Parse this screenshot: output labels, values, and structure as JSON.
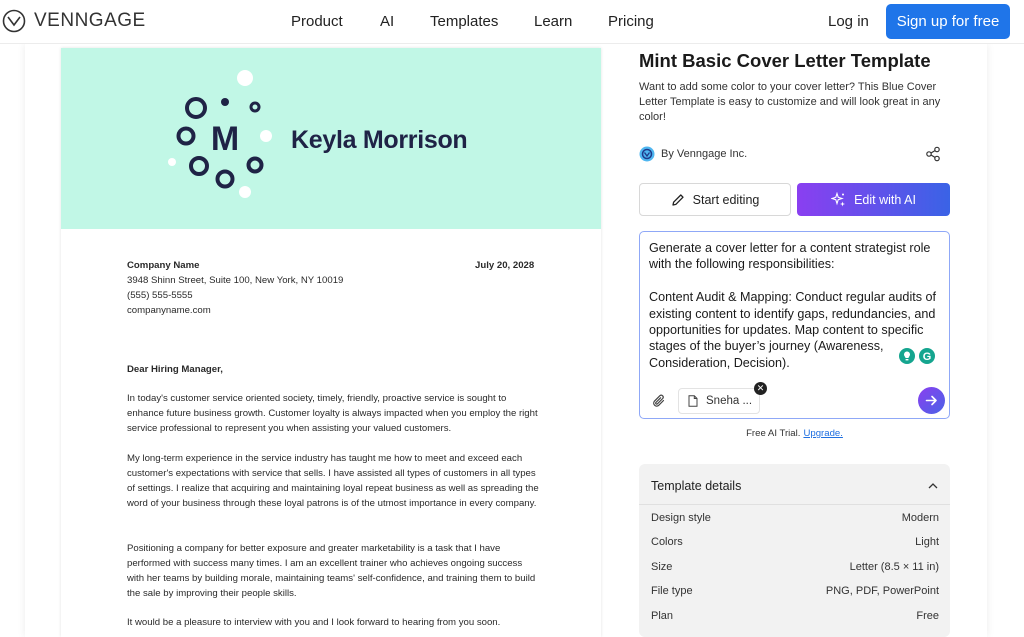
{
  "nav": {
    "brand": "VENNGAGE",
    "links": [
      "Product",
      "AI",
      "Templates",
      "Learn",
      "Pricing"
    ],
    "login": "Log in",
    "signup": "Sign up for free"
  },
  "letter": {
    "monogram": "M",
    "person_name": "Keyla Morrison",
    "company_name": "Company Name",
    "date": "July 20, 2028",
    "address": "3948 Shinn Street, Suite 100, New York, NY 10019",
    "phone": "(555) 555-5555",
    "website": "companyname.com",
    "salutation": "Dear Hiring Manager,",
    "paragraphs": [
      "In today's customer service oriented society, timely, friendly, proactive service is sought to enhance future business growth. Customer loyalty is always impacted when you employ the right service professional to represent you when assisting your valued customers.",
      "My long-term experience in the service industry has taught me how to meet and exceed each customer's expectations with service that sells. I have assisted all types of customers in all types of settings. I realize that acquiring and maintaining loyal repeat business as well as spreading the word of your business through these loyal patrons is of the utmost importance in every company.",
      "Positioning a company for better exposure and greater marketability is a task that I have performed with success many times. I am an excellent trainer who achieves ongoing success with her teams by building morale, maintaining teams' self-confidence, and training them to build the sale by improving their people skills.",
      "It would be a pleasure to interview with you and I look forward to hearing from you soon."
    ]
  },
  "panel": {
    "title": "Mint Basic Cover Letter Template",
    "description": "Want to add some color to your cover letter? This Blue Cover Letter Template is easy to customize and will look great in any color!",
    "author": "By Venngage Inc.",
    "start_editing": "Start editing",
    "edit_with_ai": "Edit with AI",
    "prompt": "Generate a cover letter for a content strategist role with the following responsibilities:\n\nContent Audit & Mapping: Conduct regular audits of existing content to identify gaps, redundancies, and opportunities for updates. Map content to specific stages of the buyer’s journey (Awareness, Consideration, Decision).",
    "attachment": "Sneha ...",
    "trial_text": "Free AI Trial.",
    "upgrade": "Upgrade."
  },
  "details": {
    "title": "Template details",
    "rows": [
      {
        "label": "Design style",
        "value": "Modern"
      },
      {
        "label": "Colors",
        "value": "Light"
      },
      {
        "label": "Size",
        "value": "Letter (8.5 × 11 in)"
      },
      {
        "label": "File type",
        "value": "PNG, PDF, PowerPoint"
      },
      {
        "label": "Plan",
        "value": "Free"
      }
    ]
  },
  "colors": {
    "accent": "#1f75e9",
    "mint": "#c1f7e6",
    "navy": "#1f2346",
    "ai_gradient_start": "#8a3ff0",
    "ai_gradient_end": "#3a63e6"
  },
  "icons": [
    "logo-icon",
    "pencil-icon",
    "sparkle-icon",
    "paperclip-icon",
    "document-icon",
    "close-icon",
    "arrow-right-icon",
    "share-icon",
    "chevron-up-icon",
    "grammarly-icon"
  ]
}
